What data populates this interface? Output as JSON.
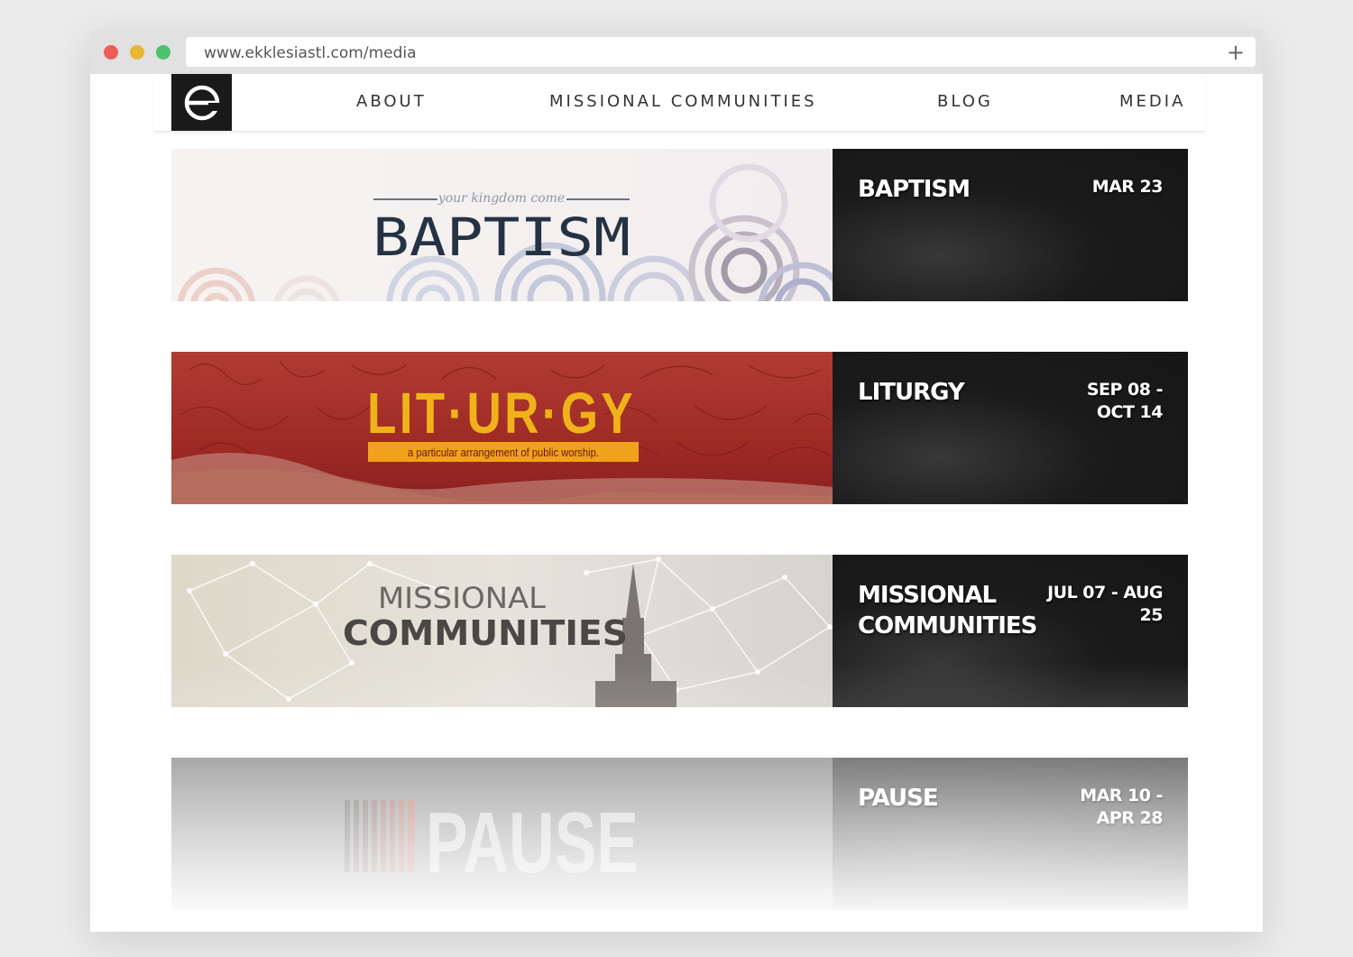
{
  "browser": {
    "url": "www.ekklesiastl.com/media",
    "new_tab_icon": "plus-icon"
  },
  "nav": {
    "logo_letter": "e",
    "items": [
      {
        "label": "ABOUT"
      },
      {
        "label": "MISSIONAL COMMUNITIES"
      },
      {
        "label": "BLOG"
      },
      {
        "label": "MEDIA"
      }
    ]
  },
  "series": [
    {
      "title": "BAPTISM",
      "date": "MAR 23",
      "banner_kicker": "your kingdom come",
      "banner_title": "BAPTISM"
    },
    {
      "title": "LITURGY",
      "date": "SEP 08 - OCT 14",
      "banner_title": "LIT·UR·GY",
      "banner_subtitle": "a particular arrangement of public worship."
    },
    {
      "title": "MISSIONAL COMMUNITIES",
      "date": "JUL 07 - AUG 25",
      "banner_line1": "MISSIONAL",
      "banner_line2": "COMMUNITIES"
    },
    {
      "title": "PAUSE",
      "date": "MAR 10 - APR 28",
      "banner_title": "PAUSE"
    }
  ],
  "colors": {
    "info_panel": "#1b1b1b",
    "liturgy_red": "#a8302b",
    "liturgy_gold": "#f0b21a",
    "baptism_navy": "#243344"
  }
}
